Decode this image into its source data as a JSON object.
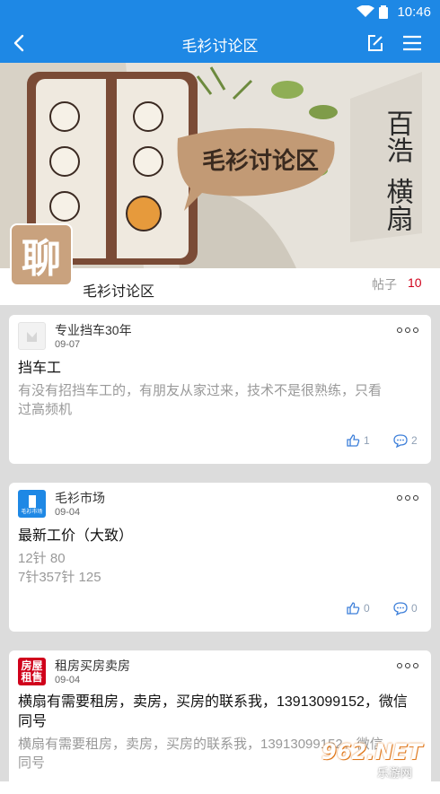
{
  "status_bar": {
    "time": "10:46"
  },
  "app_bar": {
    "title": "毛衫讨论区"
  },
  "banner": {
    "bubble_text": "毛衫讨论区",
    "side_text_1": "百浩",
    "side_text_2": "横扇"
  },
  "forum": {
    "logo_char": "聊",
    "name": "毛衫讨论区",
    "post_count_label": "帖子",
    "post_count": "10"
  },
  "posts": [
    {
      "author": "专业挡车30年",
      "date": "09-07",
      "title": "挡车工",
      "body_lines": [
        "有没有招挡车工的，有朋友从家过来，技术不是很熟练，只看",
        "过高频机"
      ],
      "likes": "1",
      "comments": "2"
    },
    {
      "author": "毛衫市场",
      "avatar_text": "毛衫市场",
      "date": "09-04",
      "title": "最新工价（大致）",
      "body_lines": [
        "12针  80",
        "7针357针 125"
      ],
      "likes": "0",
      "comments": "0"
    },
    {
      "author": "租房买房卖房",
      "avatar_text_1": "房屋",
      "avatar_text_2": "租售",
      "date": "09-04",
      "title_lines": [
        "横扇有需要租房，卖房，买房的联系我，13913099152，微信",
        "同号"
      ],
      "body_lines": [
        "横扇有需要租房，卖房，买房的联系我，13913099152，微信",
        "同号"
      ]
    }
  ],
  "watermark": {
    "brand": "962.NET",
    "sub": "乐游网"
  },
  "colors": {
    "primary": "#1e88e5",
    "count_red": "#d0021b",
    "feed_bg": "#dcdcdc"
  }
}
